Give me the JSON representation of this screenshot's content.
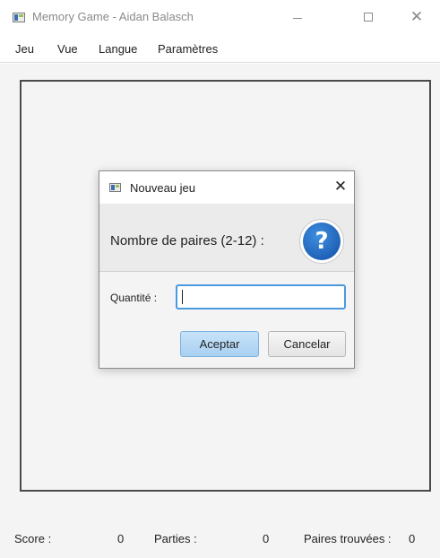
{
  "window": {
    "title": "Memory Game - Aidan Balasch",
    "icon": "app-window-icon",
    "controls": {
      "minimize": "minimize-icon",
      "maximize": "maximize-icon",
      "close": "close-icon"
    }
  },
  "menu": {
    "items": [
      {
        "label": "Jeu"
      },
      {
        "label": "Vue"
      },
      {
        "label": "Langue"
      },
      {
        "label": "Paramètres"
      }
    ]
  },
  "status": {
    "score_label": "Score :",
    "score_value": "0",
    "parties_label": "Parties :",
    "parties_value": "0",
    "paires_label": "Paires trouvées :",
    "paires_value": "0"
  },
  "dialog": {
    "title": "Nouveau jeu",
    "header_text": "Nombre de paires (2-12) :",
    "header_icon": "question-icon",
    "field_label": "Quantité :",
    "field_value": "",
    "ok_label": "Aceptar",
    "cancel_label": "Cancelar",
    "close_glyph": "✕",
    "question_glyph": "?"
  },
  "colors": {
    "accent": "#4a9ae0",
    "ok_button": "#a9d0f1",
    "question_icon": "#1f62b8"
  }
}
